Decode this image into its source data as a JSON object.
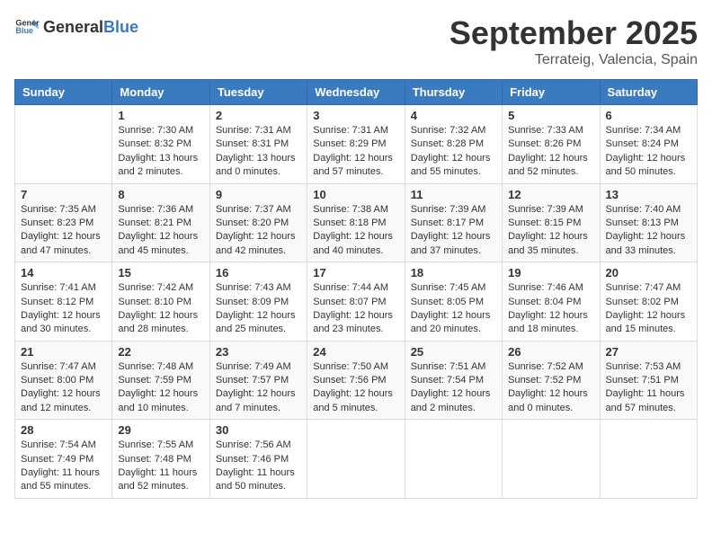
{
  "header": {
    "logo_general": "General",
    "logo_blue": "Blue",
    "month": "September 2025",
    "location": "Terrateig, Valencia, Spain"
  },
  "weekdays": [
    "Sunday",
    "Monday",
    "Tuesday",
    "Wednesday",
    "Thursday",
    "Friday",
    "Saturday"
  ],
  "weeks": [
    [
      {
        "day": "",
        "info": ""
      },
      {
        "day": "1",
        "info": "Sunrise: 7:30 AM\nSunset: 8:32 PM\nDaylight: 13 hours\nand 2 minutes."
      },
      {
        "day": "2",
        "info": "Sunrise: 7:31 AM\nSunset: 8:31 PM\nDaylight: 13 hours\nand 0 minutes."
      },
      {
        "day": "3",
        "info": "Sunrise: 7:31 AM\nSunset: 8:29 PM\nDaylight: 12 hours\nand 57 minutes."
      },
      {
        "day": "4",
        "info": "Sunrise: 7:32 AM\nSunset: 8:28 PM\nDaylight: 12 hours\nand 55 minutes."
      },
      {
        "day": "5",
        "info": "Sunrise: 7:33 AM\nSunset: 8:26 PM\nDaylight: 12 hours\nand 52 minutes."
      },
      {
        "day": "6",
        "info": "Sunrise: 7:34 AM\nSunset: 8:24 PM\nDaylight: 12 hours\nand 50 minutes."
      }
    ],
    [
      {
        "day": "7",
        "info": "Sunrise: 7:35 AM\nSunset: 8:23 PM\nDaylight: 12 hours\nand 47 minutes."
      },
      {
        "day": "8",
        "info": "Sunrise: 7:36 AM\nSunset: 8:21 PM\nDaylight: 12 hours\nand 45 minutes."
      },
      {
        "day": "9",
        "info": "Sunrise: 7:37 AM\nSunset: 8:20 PM\nDaylight: 12 hours\nand 42 minutes."
      },
      {
        "day": "10",
        "info": "Sunrise: 7:38 AM\nSunset: 8:18 PM\nDaylight: 12 hours\nand 40 minutes."
      },
      {
        "day": "11",
        "info": "Sunrise: 7:39 AM\nSunset: 8:17 PM\nDaylight: 12 hours\nand 37 minutes."
      },
      {
        "day": "12",
        "info": "Sunrise: 7:39 AM\nSunset: 8:15 PM\nDaylight: 12 hours\nand 35 minutes."
      },
      {
        "day": "13",
        "info": "Sunrise: 7:40 AM\nSunset: 8:13 PM\nDaylight: 12 hours\nand 33 minutes."
      }
    ],
    [
      {
        "day": "14",
        "info": "Sunrise: 7:41 AM\nSunset: 8:12 PM\nDaylight: 12 hours\nand 30 minutes."
      },
      {
        "day": "15",
        "info": "Sunrise: 7:42 AM\nSunset: 8:10 PM\nDaylight: 12 hours\nand 28 minutes."
      },
      {
        "day": "16",
        "info": "Sunrise: 7:43 AM\nSunset: 8:09 PM\nDaylight: 12 hours\nand 25 minutes."
      },
      {
        "day": "17",
        "info": "Sunrise: 7:44 AM\nSunset: 8:07 PM\nDaylight: 12 hours\nand 23 minutes."
      },
      {
        "day": "18",
        "info": "Sunrise: 7:45 AM\nSunset: 8:05 PM\nDaylight: 12 hours\nand 20 minutes."
      },
      {
        "day": "19",
        "info": "Sunrise: 7:46 AM\nSunset: 8:04 PM\nDaylight: 12 hours\nand 18 minutes."
      },
      {
        "day": "20",
        "info": "Sunrise: 7:47 AM\nSunset: 8:02 PM\nDaylight: 12 hours\nand 15 minutes."
      }
    ],
    [
      {
        "day": "21",
        "info": "Sunrise: 7:47 AM\nSunset: 8:00 PM\nDaylight: 12 hours\nand 12 minutes."
      },
      {
        "day": "22",
        "info": "Sunrise: 7:48 AM\nSunset: 7:59 PM\nDaylight: 12 hours\nand 10 minutes."
      },
      {
        "day": "23",
        "info": "Sunrise: 7:49 AM\nSunset: 7:57 PM\nDaylight: 12 hours\nand 7 minutes."
      },
      {
        "day": "24",
        "info": "Sunrise: 7:50 AM\nSunset: 7:56 PM\nDaylight: 12 hours\nand 5 minutes."
      },
      {
        "day": "25",
        "info": "Sunrise: 7:51 AM\nSunset: 7:54 PM\nDaylight: 12 hours\nand 2 minutes."
      },
      {
        "day": "26",
        "info": "Sunrise: 7:52 AM\nSunset: 7:52 PM\nDaylight: 12 hours\nand 0 minutes."
      },
      {
        "day": "27",
        "info": "Sunrise: 7:53 AM\nSunset: 7:51 PM\nDaylight: 11 hours\nand 57 minutes."
      }
    ],
    [
      {
        "day": "28",
        "info": "Sunrise: 7:54 AM\nSunset: 7:49 PM\nDaylight: 11 hours\nand 55 minutes."
      },
      {
        "day": "29",
        "info": "Sunrise: 7:55 AM\nSunset: 7:48 PM\nDaylight: 11 hours\nand 52 minutes."
      },
      {
        "day": "30",
        "info": "Sunrise: 7:56 AM\nSunset: 7:46 PM\nDaylight: 11 hours\nand 50 minutes."
      },
      {
        "day": "",
        "info": ""
      },
      {
        "day": "",
        "info": ""
      },
      {
        "day": "",
        "info": ""
      },
      {
        "day": "",
        "info": ""
      }
    ]
  ]
}
